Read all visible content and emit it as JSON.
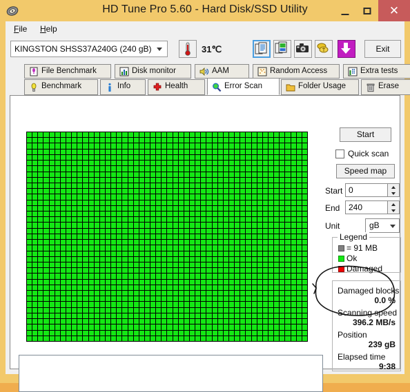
{
  "window": {
    "title": "HD Tune Pro 5.60 - Hard Disk/SSD Utility",
    "icon": "hard-disk-icon",
    "titlebar_color": "#f2c96b",
    "close_color": "#c75b5b",
    "minimize_label": "–",
    "maximize_label": "□",
    "close_label": "✕"
  },
  "menu": {
    "items": [
      {
        "label": "File",
        "accel": "F"
      },
      {
        "label": "Help",
        "accel": "H"
      }
    ]
  },
  "toolbar": {
    "drive": {
      "selected": "KINGSTON SHSS37A240G (240 gB)",
      "icon": "chevron-down-icon"
    },
    "temperature": {
      "icon": "thermometer-icon",
      "value": "31℃"
    },
    "buttons": [
      {
        "name": "copy-text-button",
        "icon": "copy-text-icon",
        "focused": true
      },
      {
        "name": "copy-image-button",
        "icon": "copy-image-icon",
        "focused": false
      },
      {
        "name": "screenshot-button",
        "icon": "camera-icon",
        "focused": false
      },
      {
        "name": "donate-button",
        "icon": "money-icon",
        "focused": false
      },
      {
        "name": "download-button",
        "icon": "download-arrow-icon",
        "focused": false
      }
    ],
    "exit_label": "Exit"
  },
  "tabs": {
    "row1": [
      {
        "label": "File Benchmark",
        "icon": "file-benchmark-icon",
        "active": false
      },
      {
        "label": "Disk monitor",
        "icon": "bar-chart-icon",
        "active": false
      },
      {
        "label": "AAM",
        "icon": "speaker-icon",
        "active": false
      },
      {
        "label": "Random Access",
        "icon": "scatter-icon",
        "active": false
      },
      {
        "label": "Extra tests",
        "icon": "extra-tests-icon",
        "active": false
      }
    ],
    "row2": [
      {
        "label": "Benchmark",
        "icon": "lightbulb-icon",
        "active": false
      },
      {
        "label": "Info",
        "icon": "info-icon",
        "active": false
      },
      {
        "label": "Health",
        "icon": "red-cross-icon",
        "active": false
      },
      {
        "label": "Error Scan",
        "icon": "magnifier-icon",
        "active": true
      },
      {
        "label": "Folder Usage",
        "icon": "folder-icon",
        "active": false
      },
      {
        "label": "Erase",
        "icon": "trash-icon",
        "active": false
      }
    ]
  },
  "error_scan": {
    "start_button": "Start",
    "quick_scan": {
      "label": "Quick scan",
      "checked": false
    },
    "speed_map_button": "Speed map",
    "range": {
      "start": {
        "label": "Start",
        "value": "0"
      },
      "end": {
        "label": "End",
        "value": "240"
      },
      "unit": {
        "label": "Unit",
        "value": "gB",
        "icon": "chevron-down-icon"
      }
    },
    "legend": {
      "title": "Legend",
      "block_size": "= 91 MB",
      "block_color": "#808080",
      "entries": [
        {
          "label": "Ok",
          "color": "#14e814"
        },
        {
          "label": "Damaged",
          "color": "#f00000"
        }
      ]
    },
    "status": {
      "items": [
        {
          "label": "Damaged blocks",
          "value": "0.0 %"
        },
        {
          "label": "Scanning speed",
          "value": "396.2 MB/s"
        },
        {
          "label": "Position",
          "value": "239 gB"
        },
        {
          "label": "Elapsed time",
          "value": "9:38"
        }
      ]
    },
    "grid": {
      "columns": 50,
      "rows": 37,
      "ok_color": "#14e814",
      "background": "#000000",
      "total_cells": 1850,
      "damaged_cells": 0
    },
    "log": {
      "text": ""
    },
    "annotation": {
      "type": "hand-drawn-ellipse",
      "targets": [
        "Scanning speed",
        "396.2 MB/s"
      ],
      "color": "#111111"
    }
  }
}
